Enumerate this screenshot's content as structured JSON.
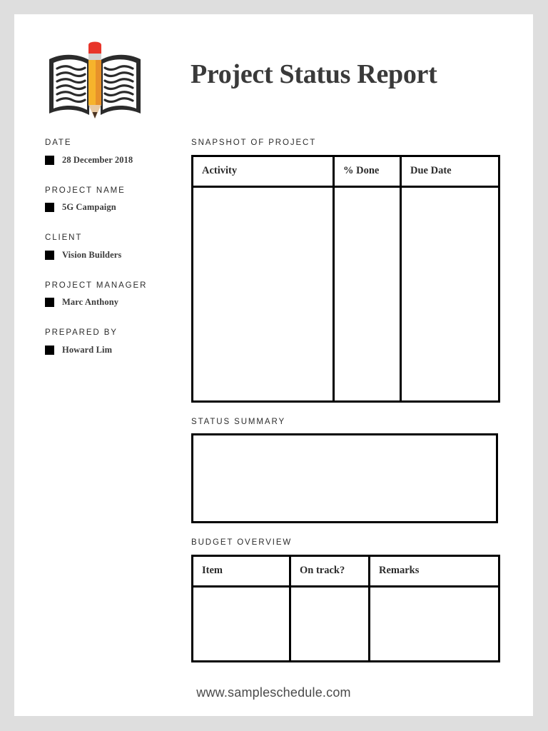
{
  "document": {
    "title": "Project Status Report",
    "logo_icon": "book-with-pencil-logo",
    "background_color": "#dedede",
    "page_color": "#ffffff",
    "ink_color": "#3a3a3a"
  },
  "sidebar": {
    "fields": [
      {
        "label": "DATE",
        "value": "28 December 2018",
        "bullet": "black-square-bullet"
      },
      {
        "label": "PROJECT NAME",
        "value": "5G Campaign",
        "bullet": "black-square-bullet"
      },
      {
        "label": "CLIENT",
        "value": "Vision Builders",
        "bullet": "black-square-bullet"
      },
      {
        "label": "PROJECT MANAGER",
        "value": "Marc Anthony",
        "bullet": "black-square-bullet"
      },
      {
        "label": "PREPARED BY",
        "value": "Howard Lim",
        "bullet": "black-square-bullet"
      }
    ]
  },
  "main": {
    "snapshot": {
      "section_label": "SNAPSHOT OF PROJECT",
      "columns": [
        "Activity",
        "% Done",
        "Due Date"
      ],
      "rows": []
    },
    "status_summary": {
      "section_label": "STATUS SUMMARY",
      "content": ""
    },
    "budget": {
      "section_label": "BUDGET OVERVIEW",
      "columns": [
        "Item",
        "On track?",
        "Remarks"
      ],
      "rows": []
    }
  },
  "footer": {
    "url": "www.sampleschedule.com"
  },
  "logo_colors": {
    "book_outline": "#2b2b2b",
    "book_page": "#ffffff",
    "pencil_eraser": "#e8352a",
    "pencil_ferrule": "#d2d2d2",
    "pencil_body_light": "#f6b32c",
    "pencil_body_dark": "#e8912a",
    "pencil_wood": "#e8c9a2",
    "pencil_tip": "#4a3526"
  }
}
